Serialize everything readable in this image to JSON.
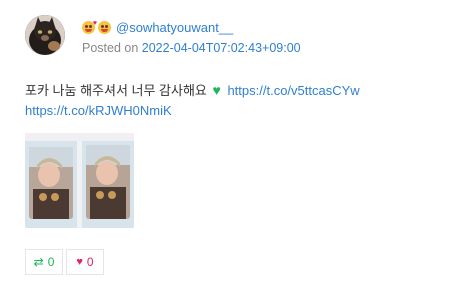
{
  "author": {
    "emoji_1": "face-blowing-kiss",
    "emoji_2": "smiling-face-with-heart-eyes",
    "username": "@sowhatyouwant__"
  },
  "meta": {
    "posted_prefix": "Posted on",
    "timestamp": "2022-04-04T07:02:43+09:00"
  },
  "tweet": {
    "text": "포카 나눔 해주셔서 너무 감사해요",
    "emoji": "green-heart",
    "link_1": "https://t.co/v5ttcasCYw",
    "link_2": "https://t.co/kRJWH0NmiK"
  },
  "actions": {
    "retweet_count": "0",
    "like_count": "0"
  },
  "colors": {
    "link": "#2f7fd1",
    "retweet": "#19b85a",
    "like": "#e0245e",
    "meta_text": "#888888"
  }
}
